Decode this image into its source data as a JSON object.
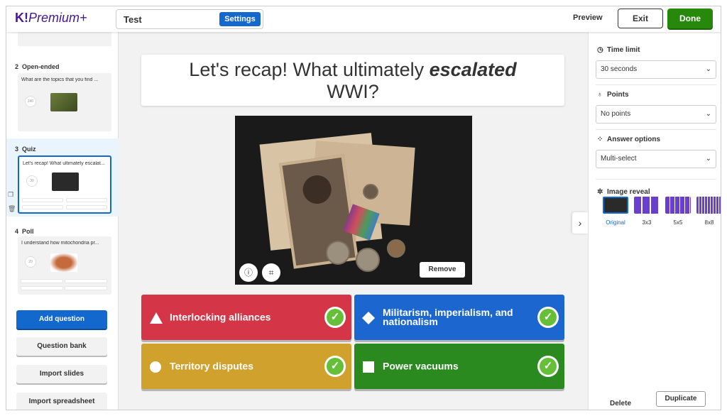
{
  "header": {
    "logo_main": "K!",
    "logo_sub": "Premium+",
    "kahoot_title": "Test",
    "settings_label": "Settings",
    "preview_label": "Preview",
    "exit_label": "Exit",
    "done_label": "Done"
  },
  "sidebar": {
    "slides": [
      {
        "number": "2",
        "type": "Open-ended",
        "text": "What are the topics that you find ...",
        "time": "240"
      },
      {
        "number": "3",
        "type": "Quiz",
        "text": "Let's recap! What ultimately escalat...",
        "time": "30"
      },
      {
        "number": "4",
        "type": "Poll",
        "text": "I understand how mitochondria pr...",
        "time": "20"
      }
    ],
    "add_question": "Add question",
    "question_bank": "Question bank",
    "import_slides": "Import slides",
    "import_spreadsheet": "Import spreadsheet"
  },
  "main": {
    "question_prefix": "Let's recap! What ultimately ",
    "question_emph": "escalated",
    "question_suffix": " WWI?",
    "remove_label": "Remove",
    "answers": [
      {
        "text": "Interlocking alliances",
        "shape": "triangle",
        "color": "#d53647"
      },
      {
        "text": "Militarism, imperialism, and nationalism",
        "shape": "diamond",
        "color": "#1b67cf"
      },
      {
        "text": "Territory disputes",
        "shape": "circle",
        "color": "#d0a12c"
      },
      {
        "text": "Power vacuums",
        "shape": "square",
        "color": "#2a8a1f"
      }
    ]
  },
  "settings_panel": {
    "time_limit_label": "Time limit",
    "time_limit_value": "30 seconds",
    "points_label": "Points",
    "points_value": "No points",
    "answer_options_label": "Answer options",
    "answer_options_value": "Multi-select",
    "image_reveal_label": "Image reveal",
    "reveal_options": [
      "Original",
      "3x3",
      "5x5",
      "8x8"
    ],
    "delete_label": "Delete",
    "duplicate_label": "Duplicate"
  },
  "colors": {
    "accent": "#1368ce",
    "done": "#26890c",
    "brand": "#46178f",
    "check": "#66bf39"
  }
}
